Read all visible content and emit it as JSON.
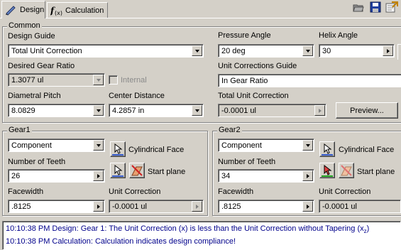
{
  "tabs": [
    {
      "label": "Design",
      "icon": "design-icon",
      "active": true
    },
    {
      "label": "Calculation",
      "icon": "calculation-icon",
      "active": false
    }
  ],
  "toolbar_icons": [
    "open-folder-icon",
    "save-icon",
    "export-icon"
  ],
  "common": {
    "title": "Common",
    "design_guide": {
      "label": "Design Guide",
      "value": "Total Unit Correction"
    },
    "desired_gear_ratio": {
      "label": "Desired Gear Ratio",
      "value": "1.3077 ul"
    },
    "internal": {
      "label": "Internal",
      "checked": false
    },
    "diametral_pitch": {
      "label": "Diametral Pitch",
      "value": "8.0829"
    },
    "center_distance": {
      "label": "Center Distance",
      "value": "4.2857 in"
    },
    "pressure_angle": {
      "label": "Pressure Angle",
      "value": "20 deg"
    },
    "helix_angle": {
      "label": "Helix Angle",
      "value": "30"
    },
    "unit_corrections_guide": {
      "label": "Unit Corrections Guide",
      "value": "In Gear Ratio"
    },
    "total_unit_correction": {
      "label": "Total Unit Correction",
      "value": "-0.0001 ul"
    },
    "preview_label": "Preview..."
  },
  "gear1": {
    "title": "Gear1",
    "type_value": "Component",
    "cylindrical_face_label": "Cylindrical Face",
    "start_plane_label": "Start plane",
    "number_of_teeth": {
      "label": "Number of Teeth",
      "value": "26"
    },
    "facewidth": {
      "label": "Facewidth",
      "value": ".8125"
    },
    "unit_correction": {
      "label": "Unit Correction",
      "value": "-0.0001 ul"
    }
  },
  "gear2": {
    "title": "Gear2",
    "type_value": "Component",
    "cylindrical_face_label": "Cylindrical Face",
    "start_plane_label": "Start plane",
    "number_of_teeth": {
      "label": "Number of Teeth",
      "value": "34"
    },
    "facewidth": {
      "label": "Facewidth",
      "value": ".8125"
    },
    "unit_correction": {
      "label": "Unit Correction",
      "value": "-0.0001 ul"
    }
  },
  "log": {
    "line1": "10:10:38 PM Design: Gear 1: The Unit Correction (x) is less than the Unit Correction without Tapering (x",
    "line1_sub": "z",
    "line1_end": ")",
    "line2": "10:10:38 PM Calculation: Calculation indicates design compliance!"
  },
  "colors": {
    "face": "#d4d0c8",
    "log_text": "#00008b",
    "select_blue": "#3a5fcd",
    "select_green": "#1fa31f"
  }
}
